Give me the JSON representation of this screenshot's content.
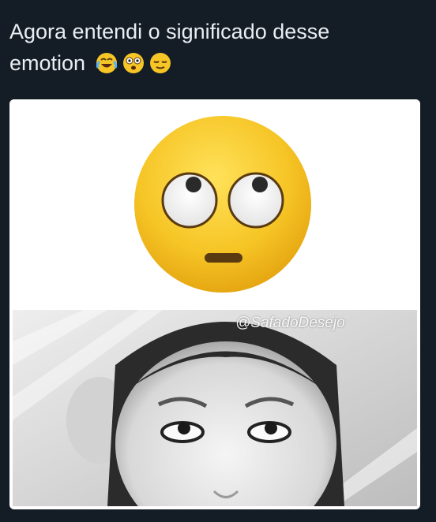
{
  "tweet": {
    "line1": "Agora entendi o significado desse",
    "line2": "emotion",
    "inline_emojis": [
      "face-with-tears-of-joy-icon",
      "dizzy-face-icon",
      "relieved-face-icon"
    ]
  },
  "media": {
    "top_image": "rolling-eyes-emoji",
    "bottom_image": "grayscale-photo-face-looking-up",
    "watermark": "@SafadoDesejo"
  },
  "colors": {
    "background": "#141d26",
    "text": "#e9eef2",
    "emoji_yellow": "#f6c526"
  }
}
